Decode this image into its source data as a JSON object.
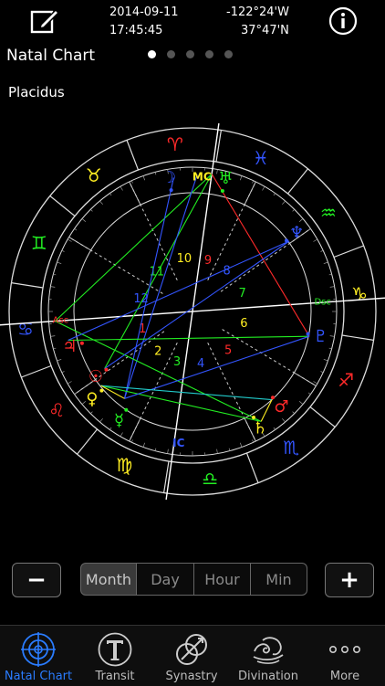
{
  "header": {
    "date": "2014-09-11",
    "time": "17:45:45",
    "longitude": "-122°24'W",
    "latitude": "37°47'N",
    "title": "Natal Chart",
    "house_system": "Placidus",
    "page_count": 5,
    "active_page": 1
  },
  "chart": {
    "sign_glyphs": [
      "♈︎",
      "♉︎",
      "♊︎",
      "♋︎",
      "♌︎",
      "♍︎",
      "♎︎",
      "♏︎",
      "♐︎",
      "♑︎",
      "♒︎",
      "♓︎"
    ],
    "sign_colors": [
      "#ff2a2a",
      "#ffee22",
      "#22ee22",
      "#3355ff",
      "#ff2a2a",
      "#ffee22",
      "#22ee22",
      "#3355ff",
      "#ff2a2a",
      "#ffee22",
      "#22ee22",
      "#3355ff"
    ],
    "house_numbers": [
      "1",
      "2",
      "3",
      "4",
      "5",
      "6",
      "7",
      "8",
      "9",
      "10",
      "11",
      "12"
    ],
    "house_colors": [
      "#ff2a2a",
      "#ffee22",
      "#22ee22",
      "#3355ff",
      "#ff2a2a",
      "#ffee22",
      "#22ee22",
      "#3355ff",
      "#ff2a2a",
      "#ffee22",
      "#22ee22",
      "#3355ff"
    ],
    "angles": {
      "asc": "Asc",
      "mc": "MC",
      "dsc": "Dsc",
      "ic": "IC"
    },
    "planets": [
      {
        "glyph": "♂︎",
        "color": "#ff2a2a"
      },
      {
        "glyph": "♄︎",
        "color": "#ffee22"
      },
      {
        "glyph": "☿︎",
        "color": "#22ee22"
      },
      {
        "glyph": "♀︎",
        "color": "#ffee22"
      },
      {
        "glyph": "☉︎",
        "color": "#ff2a2a"
      },
      {
        "glyph": "♃︎",
        "color": "#ff2a2a"
      },
      {
        "glyph": "♆︎",
        "color": "#3355ff"
      },
      {
        "glyph": "♅︎",
        "color": "#22ee22"
      },
      {
        "glyph": "☽︎",
        "color": "#3355ff"
      },
      {
        "glyph": "♇︎",
        "color": "#3355ff"
      }
    ],
    "colors": {
      "fire": "#ff2a2a",
      "earth": "#ffee22",
      "air": "#22ee22",
      "water": "#3355ff",
      "line": "#ffffff"
    }
  },
  "controls": {
    "minus_label": "−",
    "plus_label": "+",
    "segments": [
      "Month",
      "Day",
      "Hour",
      "Min"
    ],
    "selected_segment": "Month"
  },
  "tabbar": {
    "items": [
      {
        "label": "Natal Chart",
        "icon": "crosshair-icon"
      },
      {
        "label": "Transit",
        "icon": "transit-t-icon"
      },
      {
        "label": "Synastry",
        "icon": "synastry-rings-icon"
      },
      {
        "label": "Divination",
        "icon": "swirl-icon"
      },
      {
        "label": "More",
        "icon": "more-dots-icon"
      }
    ],
    "active": "Natal Chart"
  }
}
